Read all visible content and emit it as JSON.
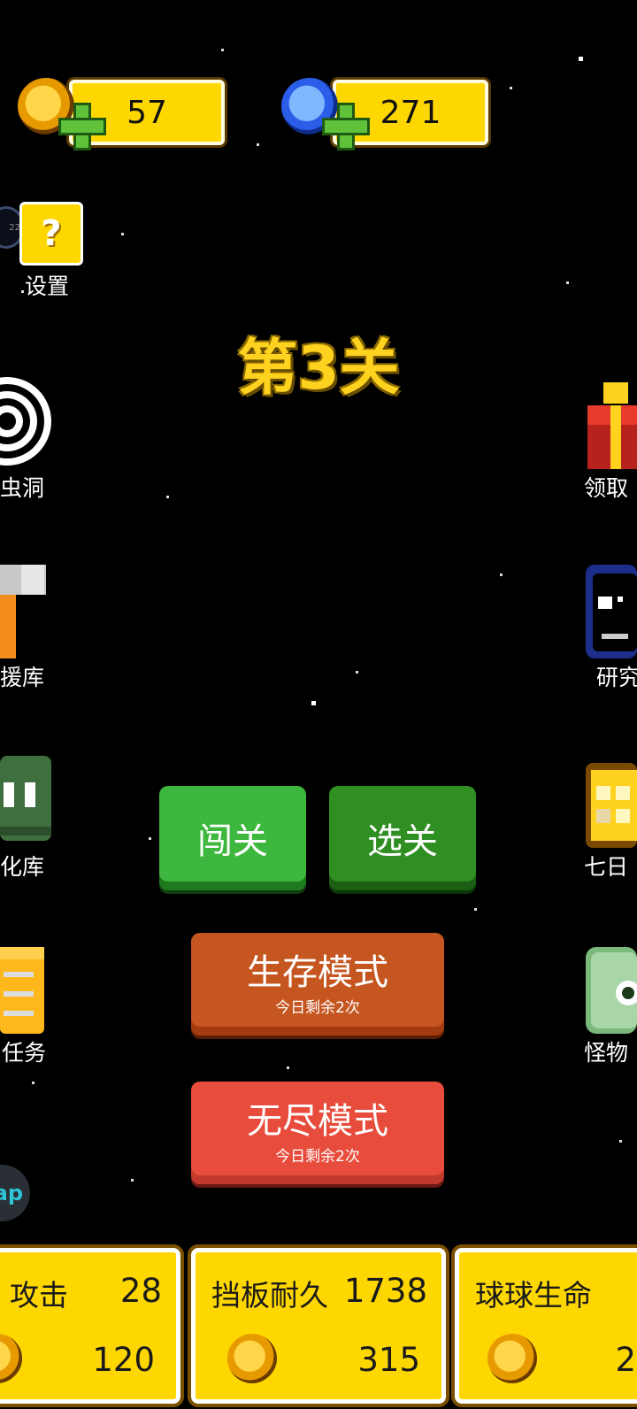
{
  "currency": {
    "gold_value": "57",
    "gem_value": "271"
  },
  "settings": {
    "label": "设置",
    "help_icon": "?"
  },
  "level": {
    "title": "第3关"
  },
  "left_menu": [
    {
      "label": "虫洞",
      "icon": "wormhole-icon"
    },
    {
      "label": "援库",
      "icon": "hammer-icon"
    },
    {
      "label": "化库",
      "icon": "slime-icon"
    },
    {
      "label": "任务",
      "icon": "scroll-icon"
    }
  ],
  "right_menu": [
    {
      "label": "领取",
      "icon": "gift-icon"
    },
    {
      "label": "研究",
      "icon": "monitor-icon"
    },
    {
      "label": "七日",
      "icon": "calendar-icon"
    },
    {
      "label": "怪物",
      "icon": "monster-icon"
    }
  ],
  "buttons": {
    "challenge": "闯关",
    "select": "选关",
    "survival": {
      "main": "生存模式",
      "sub": "今日剩余2次"
    },
    "endless": {
      "main": "无尽模式",
      "sub": "今日剩余2次"
    }
  },
  "float_button": {
    "text": "ap"
  },
  "upgrades": [
    {
      "title": "攻击",
      "value": "28",
      "cost": "120"
    },
    {
      "title": "挡板耐久",
      "value": "1738",
      "cost": "315"
    },
    {
      "title": "球球生命",
      "value": "",
      "cost": "2"
    }
  ],
  "colors": {
    "gold": "#ffd700",
    "green_button": "#3db73d",
    "dark_green_button": "#2f8f22",
    "survival_button": "#c55620",
    "endless_button": "#e74c3c"
  }
}
